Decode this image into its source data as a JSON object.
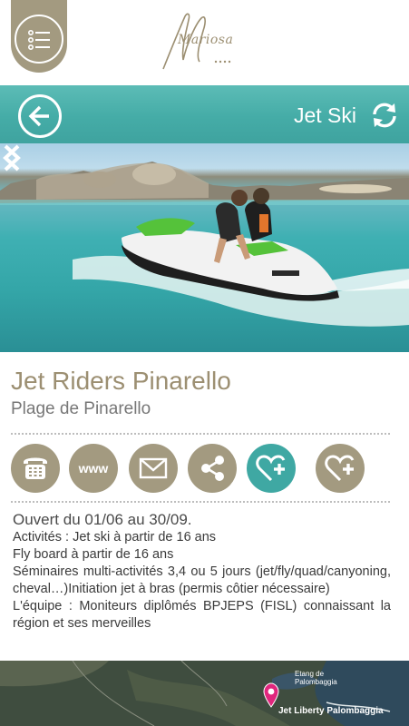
{
  "header": {
    "logo_text": "Mariosa"
  },
  "titlebar": {
    "title": "Jet Ski"
  },
  "business": {
    "name": "Jet Riders Pinarello",
    "place": "Plage de Pinarello"
  },
  "actions": [
    {
      "name": "phone",
      "icon": "phone-icon"
    },
    {
      "name": "website",
      "icon": "www-icon",
      "label": "www"
    },
    {
      "name": "email",
      "icon": "mail-icon"
    },
    {
      "name": "share",
      "icon": "share-icon"
    },
    {
      "name": "favorite-add",
      "icon": "heart-plus-icon"
    },
    {
      "name": "favorite-add-2",
      "icon": "heart-plus-icon"
    }
  ],
  "description": {
    "opening": "Ouvert du 01/06 au 30/09.",
    "lines": [
      "Activités : Jet ski à partir de 16 ans",
      "Fly board à partir de 16 ans",
      "Séminaires multi-activités 3,4 ou 5 jours (jet/fly/quad/canyoning, cheval…)Initiation jet à bras (permis côtier nécessaire)",
      "L'équipe : Moniteurs diplômés BPJEPS (FISL) connaissant la région et ses merveilles"
    ]
  },
  "map": {
    "etang_label_line1": "Etang de",
    "etang_label_line2": "Palombaggia",
    "pin_label": "Jet Liberty Palombaggia"
  },
  "colors": {
    "accent_taupe": "#a39a80",
    "accent_teal": "#3fa8a3",
    "title_text": "#9c8f72"
  }
}
